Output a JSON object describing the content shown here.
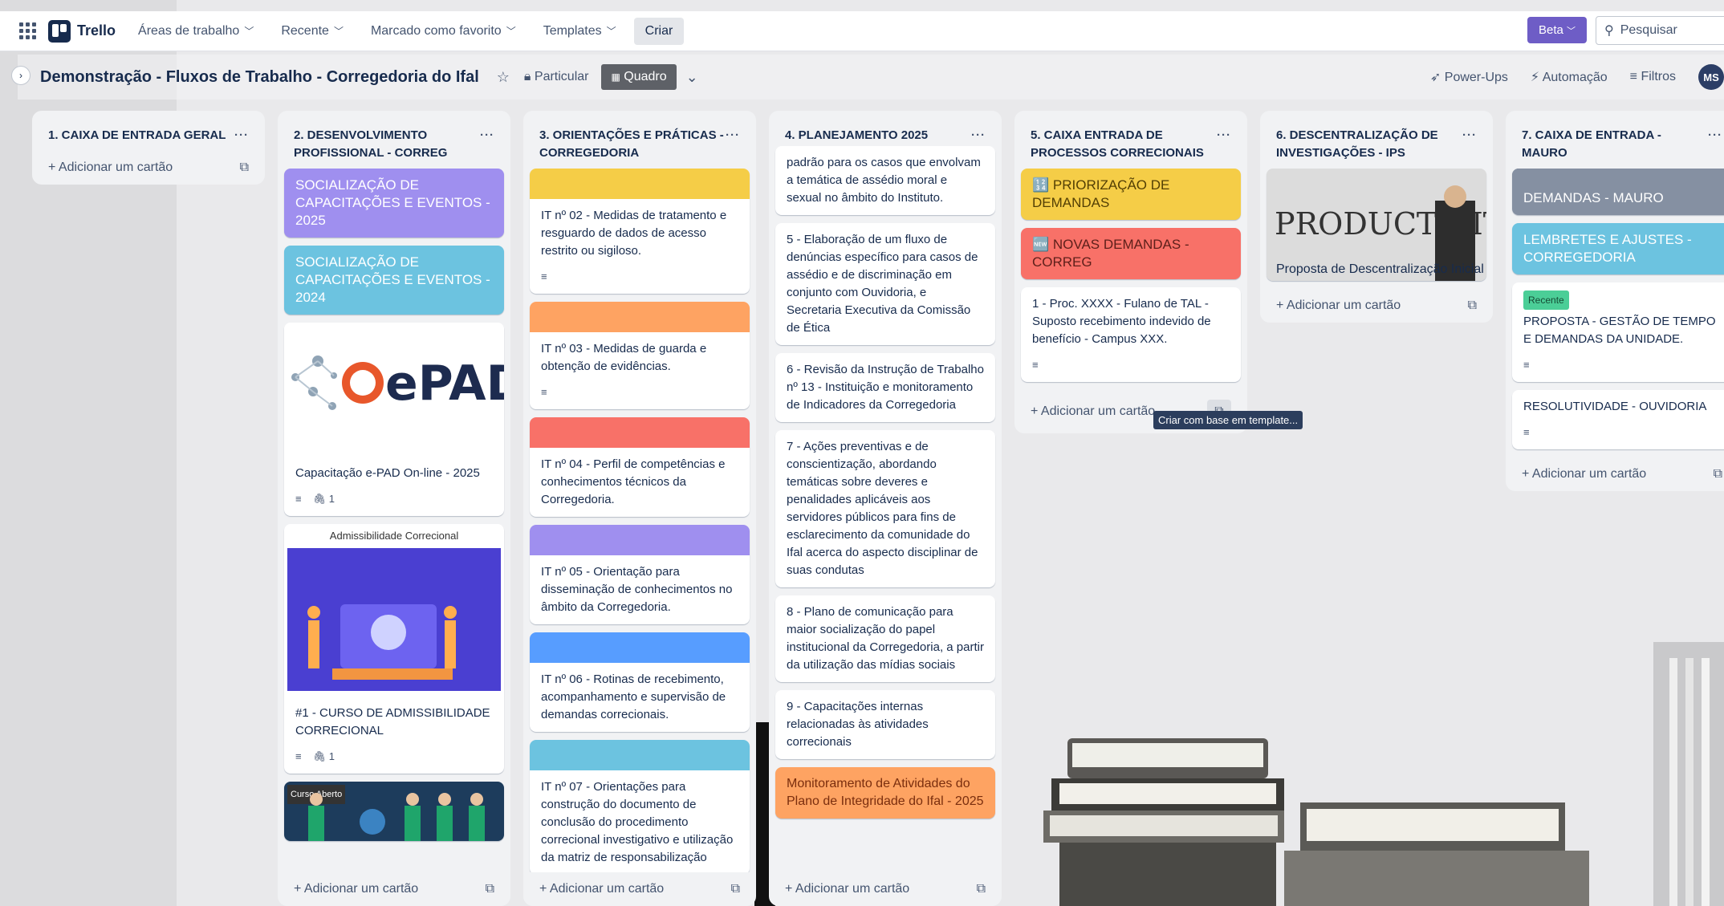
{
  "topbar": {
    "brand": "Trello",
    "nav": [
      "Áreas de trabalho",
      "Recente",
      "Marcado como favorito",
      "Templates"
    ],
    "create": "Criar",
    "beta": "Beta",
    "search_placeholder": "Pesquisar"
  },
  "board": {
    "title": "Demonstração - Fluxos de Trabalho - Corregedoria do Ifal",
    "visibility": "Particular",
    "view": "Quadro",
    "powerups": "Power-Ups",
    "automation": "Automação",
    "filters": "Filtros",
    "avatar": "MS"
  },
  "add_card": "Adicionar um cartão",
  "tooltip": "Criar com base em template...",
  "lists": [
    {
      "title": "1. CAIXA DE ENTRADA GERAL"
    },
    {
      "title": "2. DESENVOLVIMENTO PROFISSIONAL - CORREG",
      "cards": [
        "SOCIALIZAÇÃO DE CAPACITAÇÕES E EVENTOS - 2025",
        "SOCIALIZAÇÃO DE CAPACITAÇÕES E EVENTOS - 2024",
        "Capacitação e-PAD On-line - 2025",
        "Admissibilidade Correcional",
        "#1 - CURSO DE ADMISSIBILIDADE CORRECIONAL",
        "Curso Aberto"
      ],
      "epad_logo": "ePAD",
      "attach_count": "1"
    },
    {
      "title": "3. ORIENTAÇÕES E PRÁTICAS - CORREGEDORIA",
      "cards": [
        "IT nº 02 - Medidas de tratamento e resguardo de dados de acesso restrito ou sigiloso.",
        "IT nº 03 - Medidas de guarda e obtenção de evidências.",
        "IT nº 04 - Perfil de competências e conhecimentos técnicos da Corregedoria.",
        "IT nº 05 - Orientação para disseminação de conhecimentos no âmbito da Corregedoria.",
        "IT nº 06 - Rotinas de recebimento, acompanhamento e supervisão de demandas correcionais.",
        "IT nº 07 - Orientações para construção do documento de conclusão do procedimento correcional investigativo e utilização da matriz de responsabilização"
      ]
    },
    {
      "title": "4. PLANEJAMENTO 2025",
      "cards": [
        "padrão para os casos que envolvam a temática de assédio moral e sexual no âmbito do Instituto.",
        "5 - Elaboração de um fluxo de denúncias específico para casos de assédio e de discriminação em conjunto com Ouvidoria, e Secretaria Executiva da Comissão de Ética",
        "6 - Revisão da Instrução de Trabalho nº 13 - Instituição e monitoramento de Indicadores da Corregedoria",
        "7 - Ações preventivas e de conscientização, abordando temáticas sobre deveres e penalidades aplicáveis aos servidores públicos para fins de esclarecimento da comunidade do Ifal acerca do aspecto disciplinar de suas condutas",
        "8 - Plano de comunicação para maior socialização do papel institucional da Corregedoria, a partir da utilização das mídias sociais",
        "9 - Capacitações internas relacionadas às atividades correcionais",
        "Monitoramento de Atividades do Plano de Integridade do Ifal - 2025"
      ]
    },
    {
      "title": "5. CAIXA ENTRADA DE PROCESSOS CORRECIONAIS",
      "cards": [
        "🔢 PRIORIZAÇÃO DE DEMANDAS",
        "🆕 NOVAS DEMANDAS - CORREG",
        "1 - Proc. XXXX - Fulano de TAL - Suposto recebimento indevido de benefício - Campus XXX."
      ]
    },
    {
      "title": "6. DESCENTRALIZAÇÃO DE INVESTIGAÇÕES - IPS",
      "cards": [
        "Proposta de Descentralização Inicial"
      ],
      "image_word": "PRODUCTIVITY"
    },
    {
      "title": "7. CAIXA DE ENTRADA - MAURO",
      "cards": [
        "DEMANDAS - MAURO",
        "LEMBRETES E AJUSTES - CORREGEDORIA",
        "PROPOSTA - GESTÃO DE TEMPO E DEMANDAS DA UNIDADE.",
        "RESOLUTIVIDADE - OUVIDORIA"
      ],
      "label": "Recente"
    }
  ],
  "colors": {
    "purple": "#9f8fef",
    "teal": "#6cc3e0",
    "yellow": "#f5cd47",
    "orange": "#fea362",
    "red": "#f87168",
    "blue": "#579dff",
    "cyan": "#6cc3e0",
    "orange_card": "#fea362",
    "slate": "#8590a2",
    "beta": "#6e5dc6"
  }
}
